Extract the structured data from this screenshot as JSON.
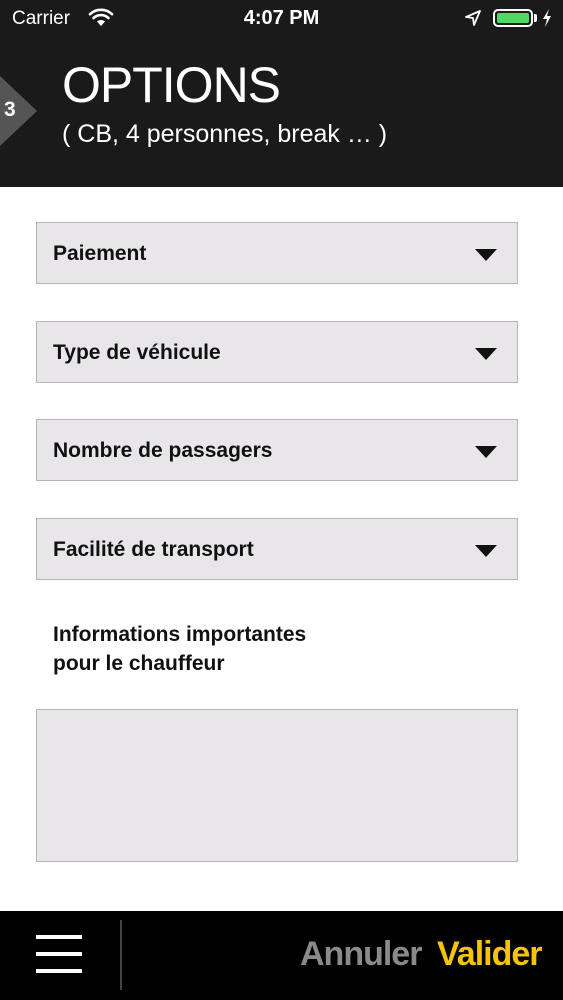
{
  "status_bar": {
    "carrier": "Carrier",
    "time": "4:07 PM",
    "battery_color": "#4cd964"
  },
  "header": {
    "step_number": "3",
    "title": "OPTIONS",
    "subtitle": "( CB, 4 personnes, break … )"
  },
  "form": {
    "selects": [
      {
        "label": "Paiement"
      },
      {
        "label": "Type de véhicule"
      },
      {
        "label": "Nombre de passagers"
      },
      {
        "label": "Facilité de transport"
      }
    ],
    "info_label_line1": "Informations importantes",
    "info_label_line2": "pour le chauffeur",
    "info_value": ""
  },
  "footer": {
    "cancel_label": "Annuler",
    "validate_label": "Valider",
    "accent_color": "#f5c400"
  },
  "icons": [
    "wifi-icon",
    "location-arrow-icon",
    "battery-icon",
    "charging-bolt-icon",
    "chevron-down-icon",
    "hamburger-menu-icon"
  ]
}
